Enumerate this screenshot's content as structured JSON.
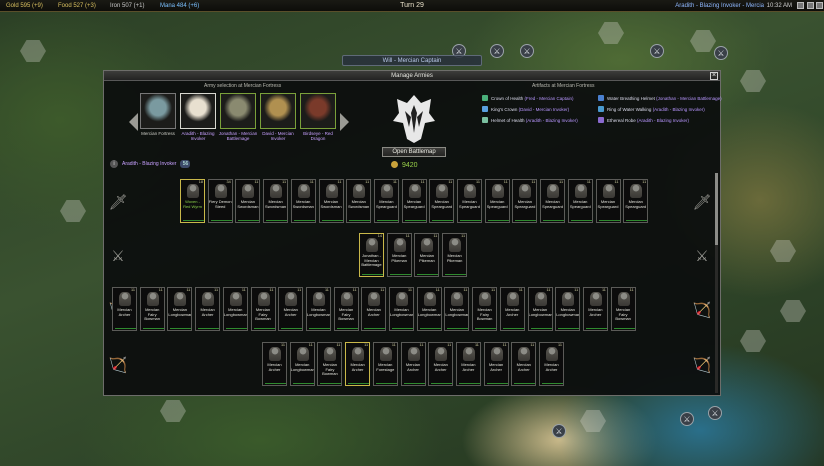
{
  "topbar": {
    "gold": "Gold 595 (+9)",
    "food": "Food 527 (+3)",
    "iron": "Iron 507 (+1)",
    "mana": "Mana 484 (+6)",
    "turn": "Turn 29",
    "player": "Aradith - Blazing Invoker - Mercia",
    "clock": "10:32 AM"
  },
  "map_label": "Will - Mercian Captain",
  "dialog": {
    "title": "Manage Armies",
    "army_selection_title": "Army selection at Mercian Fortress",
    "artifacts_title": "Artifacts at Mercian Fortress",
    "open_battlemap": "Open Battlemap",
    "gold": "9420",
    "selected_hero": "Aradith - Blazing Invoker",
    "selected_count": "56",
    "heroes": [
      {
        "name": "Mercian Fortress",
        "color": "#cfcfc8",
        "tone": "#7a9aa0"
      },
      {
        "name": "Aradith - Blazing Invoker",
        "color": "#c7a0ff",
        "tone": "#e8e0d0"
      },
      {
        "name": "Jonathan - Mercian Battlemage",
        "color": "#c7a0ff",
        "tone": "#8a8a70"
      },
      {
        "name": "David - Mercian Invoker",
        "color": "#c7a0ff",
        "tone": "#b09050"
      },
      {
        "name": "Birdseye - Red Dragon",
        "color": "#c7a0ff",
        "tone": "#7a3a2a"
      }
    ],
    "artifacts": [
      {
        "name": "Crown of Health",
        "owner": "(Fred - Mercian Captain)",
        "gem": "#4ab07a"
      },
      {
        "name": "King's Crown",
        "owner": "(David - Mercian Invoker)",
        "gem": "#5aa0e0"
      },
      {
        "name": "Helmet of Health",
        "owner": "(Aradith - Blazing Invoker)",
        "gem": "#7ac0a0"
      },
      {
        "name": "Water Breathing Helmet",
        "owner": "(Jonathan - Mercian Battlemage)",
        "gem": "#4a80d0"
      },
      {
        "name": "Ring of Water Walking",
        "owner": "(Aradith - Blazing Invoker)",
        "gem": "#4a9ad0"
      },
      {
        "name": "Ethereal Robe",
        "owner": "(Aradith - Blazing Invoker)",
        "gem": "#8a6ad0"
      }
    ],
    "rows": [
      {
        "icon": "sword-icon",
        "units": [
          {
            "name": "Woven - Red Wyrm",
            "level": "18",
            "green": true,
            "hl": true
          },
          {
            "name": "Fiery Demon Steed",
            "level": "34",
            "green": false,
            "hl": false
          },
          {
            "name": "Mercian Swordsman",
            "level": "11",
            "green": false,
            "hl": false
          },
          {
            "name": "Mercian Swordsman",
            "level": "11",
            "green": false,
            "hl": false
          },
          {
            "name": "Mercian Swordsman",
            "level": "11",
            "green": false,
            "hl": false
          },
          {
            "name": "Mercian Swordsman",
            "level": "11",
            "green": false,
            "hl": false
          },
          {
            "name": "Mercian Swordsman",
            "level": "11",
            "green": false,
            "hl": false
          },
          {
            "name": "Mercian Spearguard",
            "level": "11",
            "green": false,
            "hl": false
          },
          {
            "name": "Mercian Spearguard",
            "level": "11",
            "green": false,
            "hl": false
          },
          {
            "name": "Mercian Spearguard",
            "level": "11",
            "green": false,
            "hl": false
          },
          {
            "name": "Mercian Spearguard",
            "level": "11",
            "green": false,
            "hl": false
          },
          {
            "name": "Mercian Spearguard",
            "level": "11",
            "green": false,
            "hl": false
          },
          {
            "name": "Mercian Spearguard",
            "level": "11",
            "green": false,
            "hl": false
          },
          {
            "name": "Mercian Spearguard",
            "level": "11",
            "green": false,
            "hl": false
          },
          {
            "name": "Mercian Spearguard",
            "level": "11",
            "green": false,
            "hl": false
          },
          {
            "name": "Mercian Spearguard",
            "level": "11",
            "green": false,
            "hl": false
          },
          {
            "name": "Mercian Spearguard",
            "level": "11",
            "green": false,
            "hl": false
          }
        ]
      },
      {
        "icon": "crossed-swords-icon",
        "units": [
          {
            "name": "Jonathan - Mercian Battlemage",
            "level": "14",
            "green": false,
            "hl": true
          },
          {
            "name": "Mercian Pikeman",
            "level": "11",
            "green": false,
            "hl": false
          },
          {
            "name": "Mercian Pikeman",
            "level": "11",
            "green": false,
            "hl": false
          },
          {
            "name": "Mercian Pikeman",
            "level": "11",
            "green": false,
            "hl": false
          }
        ]
      },
      {
        "icon": "bow-icon",
        "units": [
          {
            "name": "Mercian Archer",
            "level": "11",
            "green": false,
            "hl": false
          },
          {
            "name": "Mercian Fairy Bowman",
            "level": "11",
            "green": false,
            "hl": false
          },
          {
            "name": "Mercian Longbowman",
            "level": "11",
            "green": false,
            "hl": false
          },
          {
            "name": "Mercian Archer",
            "level": "11",
            "green": false,
            "hl": false
          },
          {
            "name": "Mercian Longbowman",
            "level": "11",
            "green": false,
            "hl": false
          },
          {
            "name": "Mercian Fairy Bowman",
            "level": "11",
            "green": false,
            "hl": false
          },
          {
            "name": "Mercian Archer",
            "level": "11",
            "green": false,
            "hl": false
          },
          {
            "name": "Mercian Longbowman",
            "level": "11",
            "green": false,
            "hl": false
          },
          {
            "name": "Mercian Fairy Bowman",
            "level": "11",
            "green": false,
            "hl": false
          },
          {
            "name": "Mercian Archer",
            "level": "11",
            "green": false,
            "hl": false
          },
          {
            "name": "Mercian Longbowman",
            "level": "11",
            "green": false,
            "hl": false
          },
          {
            "name": "Mercian Longbowman",
            "level": "11",
            "green": false,
            "hl": false
          },
          {
            "name": "Mercian Longbowman",
            "level": "11",
            "green": false,
            "hl": false
          },
          {
            "name": "Mercian Fairy Bowman",
            "level": "11",
            "green": false,
            "hl": false
          },
          {
            "name": "Mercian Archer",
            "level": "11",
            "green": false,
            "hl": false
          },
          {
            "name": "Mercian Longbowman",
            "level": "11",
            "green": false,
            "hl": false
          },
          {
            "name": "Mercian Longbowman",
            "level": "11",
            "green": false,
            "hl": false
          },
          {
            "name": "Mercian Archer",
            "level": "11",
            "green": false,
            "hl": false
          },
          {
            "name": "Mercian Fairy Bowman",
            "level": "11",
            "green": false,
            "hl": false
          }
        ]
      },
      {
        "icon": "bow-icon",
        "units": [
          {
            "name": "Mercian Archer",
            "level": "11",
            "green": false,
            "hl": false
          },
          {
            "name": "Mercian Longbowman",
            "level": "11",
            "green": false,
            "hl": false
          },
          {
            "name": "Mercian Fairy Bowman",
            "level": "11",
            "green": false,
            "hl": false
          },
          {
            "name": "Mercian Archer",
            "level": "11",
            "green": false,
            "hl": true
          },
          {
            "name": "Mercian Forestage",
            "level": "11",
            "green": false,
            "hl": false
          },
          {
            "name": "Mercian Archer",
            "level": "11",
            "green": false,
            "hl": false
          },
          {
            "name": "Mercian Archer",
            "level": "11",
            "green": false,
            "hl": false
          },
          {
            "name": "Mercian Archer",
            "level": "11",
            "green": false,
            "hl": false
          },
          {
            "name": "Mercian Archer",
            "level": "11",
            "green": false,
            "hl": false
          },
          {
            "name": "Mercian Archer",
            "level": "11",
            "green": false,
            "hl": false
          },
          {
            "name": "Mercian Archer",
            "level": "11",
            "green": false,
            "hl": false
          }
        ]
      }
    ]
  }
}
